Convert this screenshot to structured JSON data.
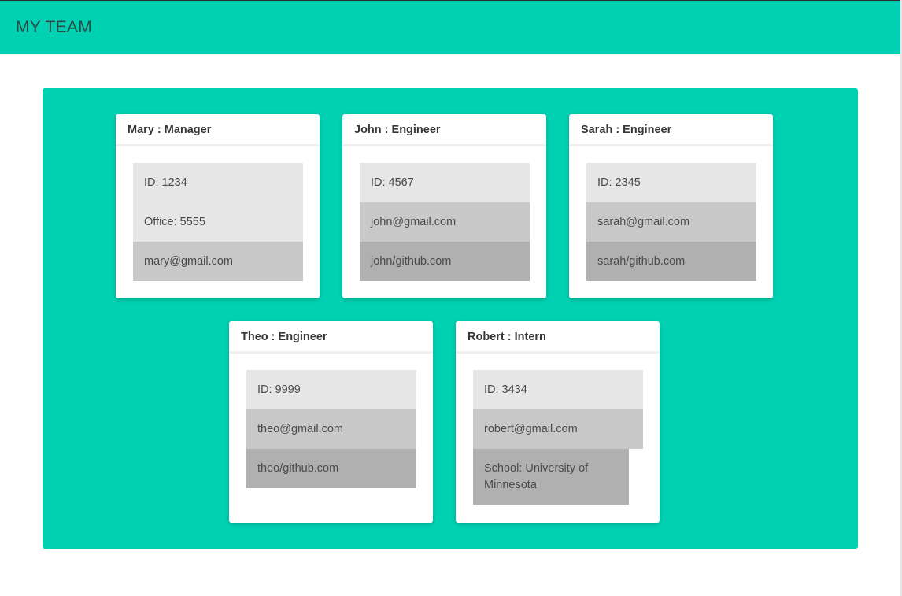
{
  "header": {
    "title": "MY TEAM"
  },
  "colors": {
    "accent": "#00d1b2",
    "row_light": "#e6e6e6",
    "row_mid": "#c8c8c8",
    "row_dark": "#b0b0b0"
  },
  "team": [
    {
      "heading": "Mary : Manager",
      "id": "ID: 1234",
      "office": "Office: 5555",
      "email": "mary@gmail.com"
    },
    {
      "heading": "John : Engineer",
      "id": "ID: 4567",
      "email": "john@gmail.com",
      "github": "john/github.com"
    },
    {
      "heading": "Sarah : Engineer",
      "id": "ID: 2345",
      "email": "sarah@gmail.com",
      "github": "sarah/github.com"
    },
    {
      "heading": "Theo : Engineer",
      "id": "ID: 9999",
      "email": "theo@gmail.com",
      "github": "theo/github.com"
    },
    {
      "heading": "Robert : Intern",
      "id": "ID: 3434",
      "email": "robert@gmail.com",
      "school": "School: University of Minnesota"
    }
  ]
}
